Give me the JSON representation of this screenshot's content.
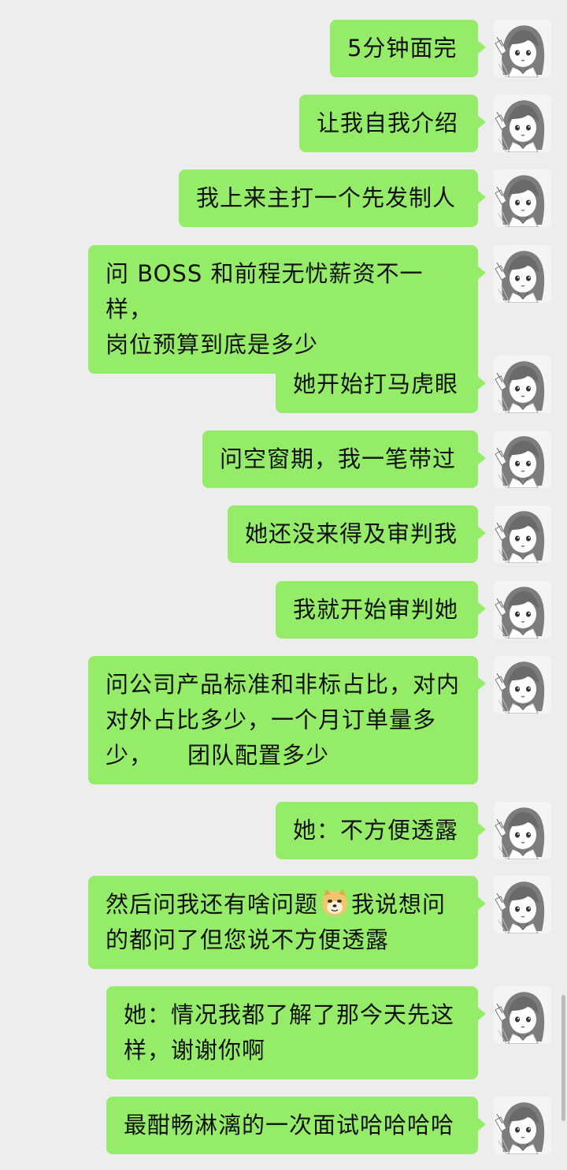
{
  "colors": {
    "background": "#ededed",
    "bubble": "#95ec69",
    "text": "#111111"
  },
  "avatar_icon": "girl-avatar-icon",
  "messages": [
    {
      "text": "5分钟面完"
    },
    {
      "text": "让我自我介绍"
    },
    {
      "text": "我上来主打一个先发制人"
    },
    {
      "line1": "问 BOSS 和前程无忧薪资不一样，",
      "line2": "岗位预算到底是多少"
    },
    {
      "text": "她开始打马虎眼"
    },
    {
      "text": "问空窗期，我一笔带过"
    },
    {
      "text": "她还没来得及审判我"
    },
    {
      "text": "我就开始审判她"
    },
    {
      "line1": "问公司产品标准和非标占比，对内",
      "line2": "对外占比多少，一个月订单量多",
      "line3a": "少，",
      "line3b": "团队配置多少"
    },
    {
      "text": "她：不方便透露"
    },
    {
      "line1a": "然后问我还有啥问题",
      "emoji": "doge-emoji-icon",
      "line1b": "我说想问",
      "line2": "的都问了但您说不方便透露"
    },
    {
      "line1": "她：情况我都了解了那今天先这",
      "line2": "样，谢谢你啊"
    },
    {
      "text": "最酣畅淋漓的一次面试哈哈哈哈"
    }
  ]
}
